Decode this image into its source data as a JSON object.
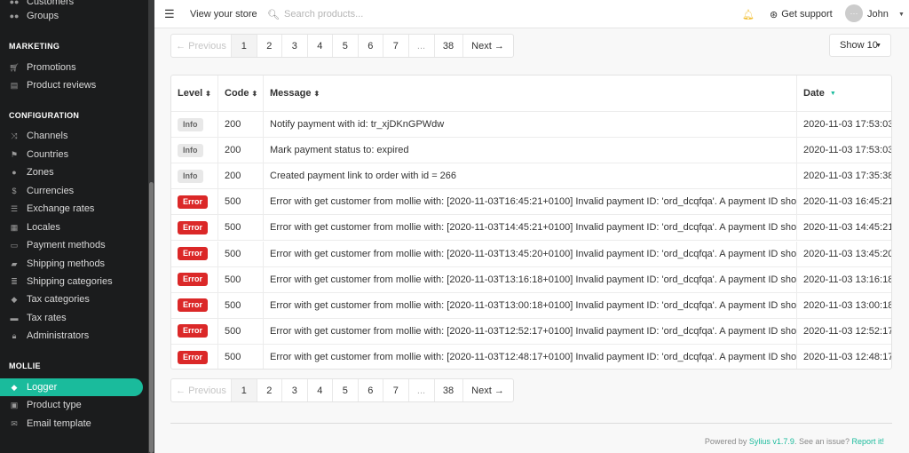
{
  "sidebar": {
    "top_items": [
      {
        "label": "Customers",
        "icon": "users-icon"
      },
      {
        "label": "Groups",
        "icon": "users-icon"
      }
    ],
    "marketing": {
      "heading": "MARKETING",
      "items": [
        {
          "label": "Promotions",
          "icon": "cart-icon"
        },
        {
          "label": "Product reviews",
          "icon": "newspaper-icon"
        }
      ]
    },
    "configuration": {
      "heading": "CONFIGURATION",
      "items": [
        {
          "label": "Channels",
          "icon": "shuffle-icon"
        },
        {
          "label": "Countries",
          "icon": "flag-icon"
        },
        {
          "label": "Zones",
          "icon": "globe-icon"
        },
        {
          "label": "Currencies",
          "icon": "dollar-icon"
        },
        {
          "label": "Exchange rates",
          "icon": "sliders-icon"
        },
        {
          "label": "Locales",
          "icon": "translate-icon"
        },
        {
          "label": "Payment methods",
          "icon": "card-icon"
        },
        {
          "label": "Shipping methods",
          "icon": "truck-icon"
        },
        {
          "label": "Shipping categories",
          "icon": "list-icon"
        },
        {
          "label": "Tax categories",
          "icon": "tags-icon"
        },
        {
          "label": "Tax rates",
          "icon": "money-icon"
        },
        {
          "label": "Administrators",
          "icon": "lock-icon"
        }
      ]
    },
    "mollie": {
      "heading": "MOLLIE",
      "items": [
        {
          "label": "Logger",
          "icon": "tags-icon",
          "active": true
        },
        {
          "label": "Product type",
          "icon": "cubes-icon"
        },
        {
          "label": "Email template",
          "icon": "mail-icon"
        }
      ]
    }
  },
  "topbar": {
    "view_store": "View your store",
    "search_placeholder": "Search products...",
    "support": "Get support",
    "user_initials": "···",
    "user_name": "John"
  },
  "pagination": {
    "prev": "← Previous",
    "pages": [
      "1",
      "2",
      "3",
      "4",
      "5",
      "6",
      "7",
      "...",
      "38"
    ],
    "next": "Next →",
    "current": "1"
  },
  "show_button": "Show 10",
  "table": {
    "headers": {
      "level": "Level",
      "code": "Code",
      "message": "Message",
      "date": "Date"
    },
    "rows": [
      {
        "level": "Info",
        "code": "200",
        "message": "Notify payment with id: tr_xjDKnGPWdw",
        "date": "2020-11-03 17:53:03"
      },
      {
        "level": "Info",
        "code": "200",
        "message": "Mark payment status to: expired",
        "date": "2020-11-03 17:53:03"
      },
      {
        "level": "Info",
        "code": "200",
        "message": "Created payment link to order with id = 266",
        "date": "2020-11-03 17:35:38"
      },
      {
        "level": "Error",
        "code": "500",
        "message": "Error with get customer from mollie with: [2020-11-03T16:45:21+0100] Invalid payment ID: 'ord_dcqfqa'. A payment ID should start with 'tr_'.",
        "date": "2020-11-03 16:45:21"
      },
      {
        "level": "Error",
        "code": "500",
        "message": "Error with get customer from mollie with: [2020-11-03T14:45:21+0100] Invalid payment ID: 'ord_dcqfqa'. A payment ID should start with 'tr_'.",
        "date": "2020-11-03 14:45:21"
      },
      {
        "level": "Error",
        "code": "500",
        "message": "Error with get customer from mollie with: [2020-11-03T13:45:20+0100] Invalid payment ID: 'ord_dcqfqa'. A payment ID should start with 'tr_'.",
        "date": "2020-11-03 13:45:20"
      },
      {
        "level": "Error",
        "code": "500",
        "message": "Error with get customer from mollie with: [2020-11-03T13:16:18+0100] Invalid payment ID: 'ord_dcqfqa'. A payment ID should start with 'tr_'.",
        "date": "2020-11-03 13:16:18"
      },
      {
        "level": "Error",
        "code": "500",
        "message": "Error with get customer from mollie with: [2020-11-03T13:00:18+0100] Invalid payment ID: 'ord_dcqfqa'. A payment ID should start with 'tr_'.",
        "date": "2020-11-03 13:00:18"
      },
      {
        "level": "Error",
        "code": "500",
        "message": "Error with get customer from mollie with: [2020-11-03T12:52:17+0100] Invalid payment ID: 'ord_dcqfqa'. A payment ID should start with 'tr_'.",
        "date": "2020-11-03 12:52:17"
      },
      {
        "level": "Error",
        "code": "500",
        "message": "Error with get customer from mollie with: [2020-11-03T12:48:17+0100] Invalid payment ID: 'ord_dcqfqa'. A payment ID should start with 'tr_'.",
        "date": "2020-11-03 12:48:17"
      }
    ]
  },
  "footer": {
    "prefix": "Powered by ",
    "brand": "Sylius v1.7.9",
    "middle": ". See an issue? ",
    "report": "Report it!"
  },
  "colors": {
    "accent": "#1abb9c",
    "error": "#db2828",
    "sidebar_bg": "#1b1c1d"
  }
}
